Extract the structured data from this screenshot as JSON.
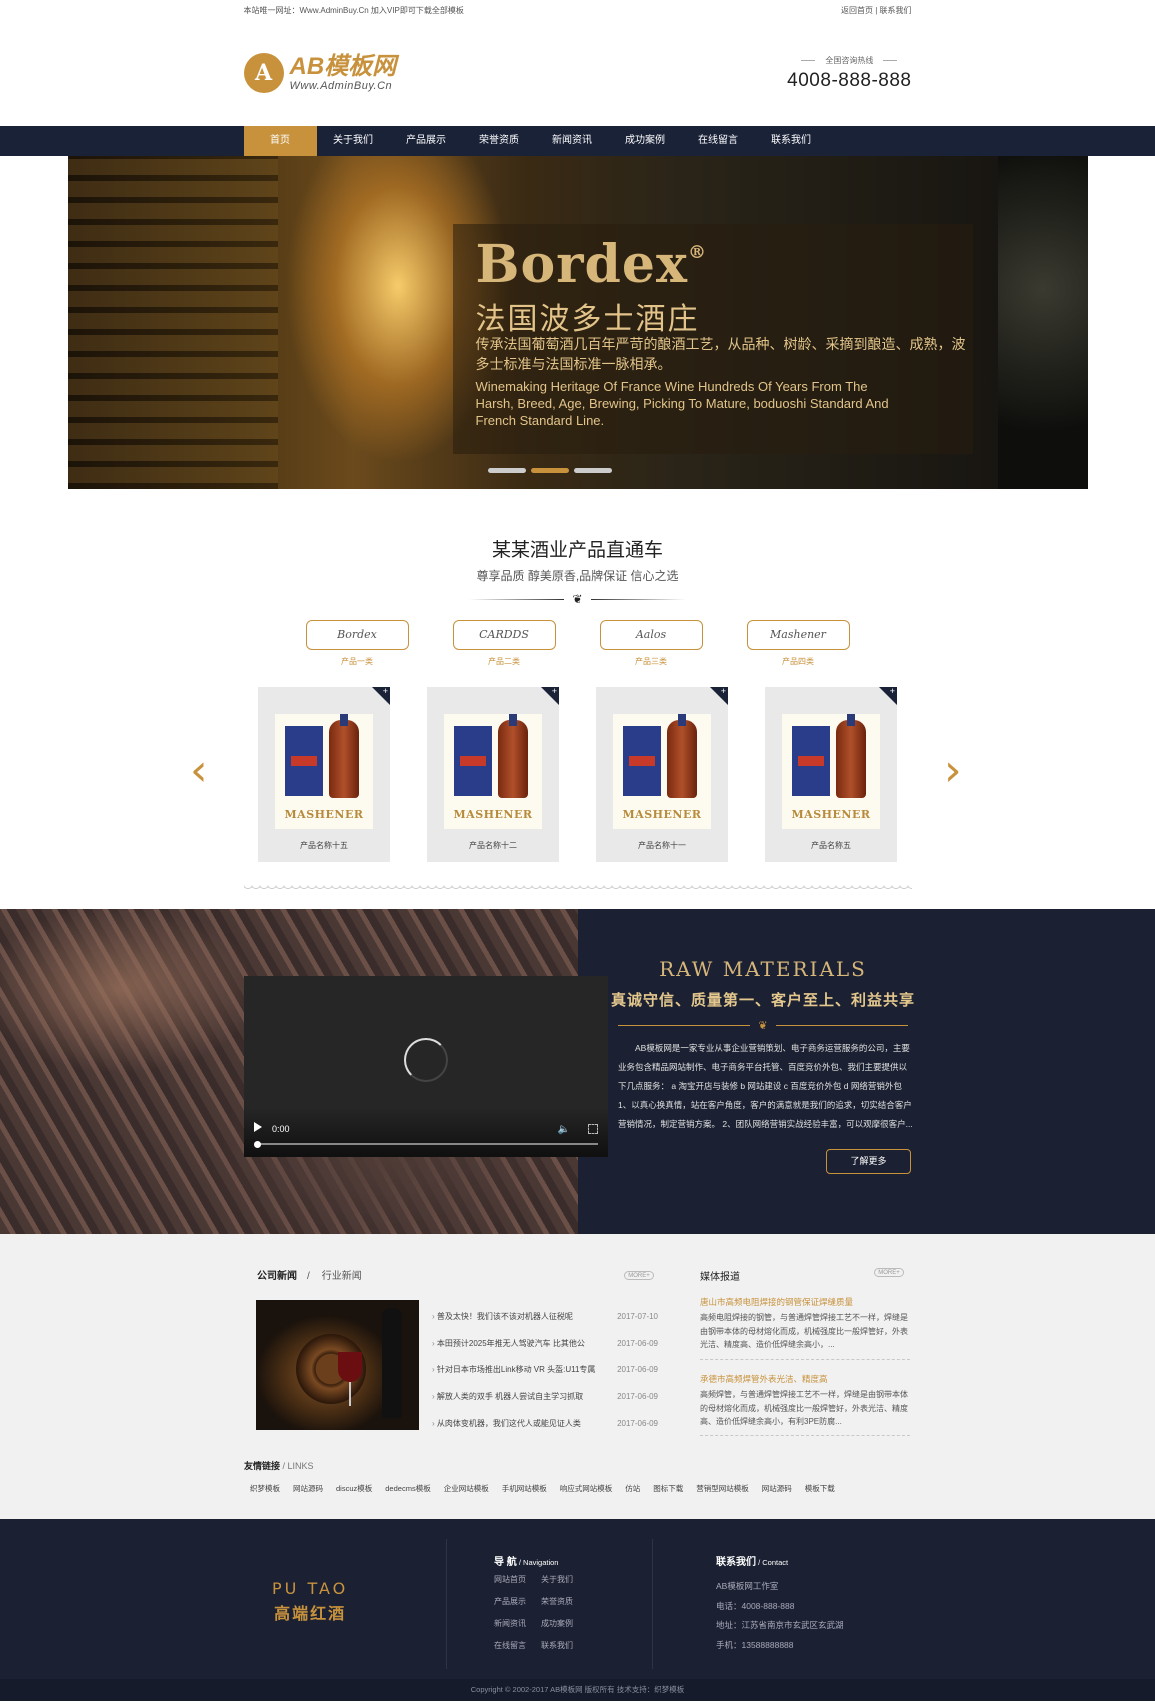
{
  "topbar": {
    "left_text": "本站唯一网址：Www.AdminBuy.Cn 加入VIP即可下载全部模板",
    "home_link": "返回首页",
    "separator": "|",
    "contact_link": "联系我们"
  },
  "header": {
    "logo_mark": "A",
    "logo_name": "AB模板网",
    "logo_url": "Www.AdminBuy.Cn",
    "hotline_label": "全国咨询热线",
    "hotline_number": "4008-888-888"
  },
  "nav": {
    "items": [
      "首页",
      "关于我们",
      "产品展示",
      "荣誉资质",
      "新闻资讯",
      "成功案例",
      "在线留言",
      "联系我们"
    ],
    "active_index": 0
  },
  "banner": {
    "title": "Bordex",
    "title_mark": "®",
    "subtitle": "法国波多士酒庄",
    "desc": "传承法国葡萄酒几百年严苛的酿酒工艺，从品种、树龄、采摘到酿造、成熟，波多士标准与法国标准一脉相承。",
    "desc_en": "Winemaking Heritage Of France Wine Hundreds Of Years From The Harsh, Breed, Age, Brewing, Picking To Mature, boduoshi Standard And French Standard Line.",
    "slide_count": 3,
    "active_slide": 2
  },
  "products": {
    "title": "某某酒业产品直通车",
    "subtitle": "尊享品质 醇美原香,品牌保证 信心之选",
    "ornament": "❦",
    "categories": [
      {
        "script": "Bordex",
        "label": "产品一类"
      },
      {
        "script": "CARDDS",
        "label": "产品二类"
      },
      {
        "script": "Aalos",
        "label": "产品三类"
      },
      {
        "script": "Mashener",
        "label": "产品四类"
      }
    ],
    "items": [
      {
        "name": "产品名称十五",
        "brand": "MASHENER"
      },
      {
        "name": "产品名称十二",
        "brand": "MASHENER"
      },
      {
        "name": "产品名称十一",
        "brand": "MASHENER"
      },
      {
        "name": "产品名称五",
        "brand": "MASHENER"
      }
    ],
    "prev_arrow": "‹",
    "next_arrow": "›",
    "plus": "+"
  },
  "raw": {
    "title": "RAW MATERIALS",
    "slogan": "真诚守信、质量第一、客户至上、利益共享",
    "ornament": "❦",
    "text": "AB模板网是一家专业从事企业营销策划、电子商务运营服务的公司，主要业务包含精品网站制作、电子商务平台托管、百度竞价外包、我们主要提供以下几点服务： a 淘宝开店与装修 b 网站建设 c 百度竞价外包 d 网络营销外包 1、以真心换真情，站在客户角度，客户的满意就是我们的追求，切实结合客户营销情况，制定营销方案。 2、团队网络营销实战经验丰富，可以观摩很客户...",
    "button": "了解更多",
    "video_time": "0:00",
    "video_volume_icon": "🔈"
  },
  "news": {
    "tab_active": "公司新闻",
    "tab_sep": "/",
    "tab_other": "行业新闻",
    "more": "MORE+",
    "items": [
      {
        "title": "普及太快！我们该不该对机器人征税呢",
        "date": "2017-07-10"
      },
      {
        "title": "本田预计2025年推无人驾驶汽车 比其他公",
        "date": "2017-06-09"
      },
      {
        "title": "针对日本市场推出Link移动 VR 头盔:U11专属",
        "date": "2017-06-09"
      },
      {
        "title": "解放人类的双手 机器人尝试自主学习抓取",
        "date": "2017-06-09"
      },
      {
        "title": "从肉体变机器，我们这代人或能见证人类",
        "date": "2017-06-09"
      }
    ]
  },
  "media": {
    "title": "媒体报道",
    "more": "MORE+",
    "items": [
      {
        "title": "唐山市高频电阻焊接的钢管保证焊缝质量",
        "body": "高频电阻焊接的钢管，与普通焊管焊接工艺不一样，焊缝是由钢带本体的母材熔化而成，机械强度比一般焊管好，外表光洁、精度高、造价低焊缝余高小，..."
      },
      {
        "title": "承德市高频焊管外表光洁、精度高",
        "body": "高频焊管，与普通焊管焊接工艺不一样，焊缝是由钢带本体的母材熔化而成，机械强度比一般焊管好，外表光洁、精度高、造价低焊缝余高小，有利3PE防腐..."
      }
    ]
  },
  "links": {
    "title": "友情链接",
    "title_en": " / LINKS",
    "items": [
      "织梦模板",
      "网站源码",
      "discuz模板",
      "dedecms模板",
      "企业网站模板",
      "手机网站模板",
      "响应式网站模板",
      "仿站",
      "图标下载",
      "营销型网站模板",
      "网站源码",
      "模板下载"
    ]
  },
  "footer": {
    "logo_en": "PU TAO",
    "logo_cn": "高端红酒",
    "nav_title": "导 航",
    "nav_title_en": " / Navigation",
    "nav_items": [
      "网站首页",
      "关于我们",
      "产品展示",
      "荣誉资质",
      "新闻资讯",
      "成功案例",
      "在线留言",
      "联系我们"
    ],
    "contact_title": "联系我们",
    "contact_title_en": " / Contact",
    "contact_lines": [
      "AB模板网工作室",
      "电话：4008-888-888",
      "地址：江苏省南京市玄武区玄武湖",
      "手机：13588888888"
    ],
    "copyright": "Copyright © 2002-2017 AB模板网 版权所有 技术支持：织梦模板"
  },
  "colors": {
    "accent": "#c8923d",
    "navy": "#1a2238"
  }
}
